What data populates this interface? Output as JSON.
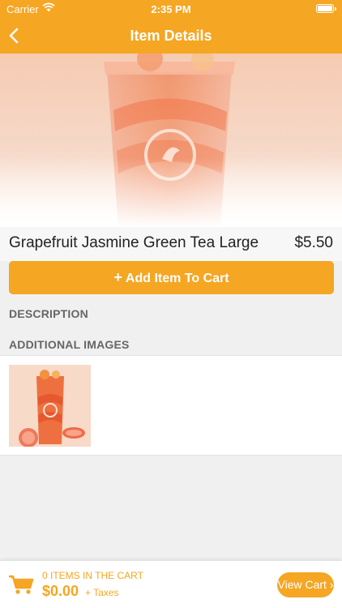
{
  "status": {
    "carrier": "Carrier",
    "time": "2:35 PM"
  },
  "nav": {
    "title": "Item Details",
    "back_icon": "chevron-left-icon"
  },
  "item": {
    "name": "Grapefruit Jasmine Green Tea Large",
    "price": "$5.50"
  },
  "add_button": {
    "icon": "+",
    "label": "Add Item To Cart"
  },
  "sections": {
    "description": "DESCRIPTION",
    "additional_images": "ADDITIONAL IMAGES"
  },
  "cart": {
    "items_label": "0 ITEMS IN THE CART",
    "total": "$0.00",
    "taxes": "+ Taxes",
    "view_cart": "View Cart ›"
  },
  "colors": {
    "brand": "#f5a623",
    "background": "#f0f0f0"
  }
}
